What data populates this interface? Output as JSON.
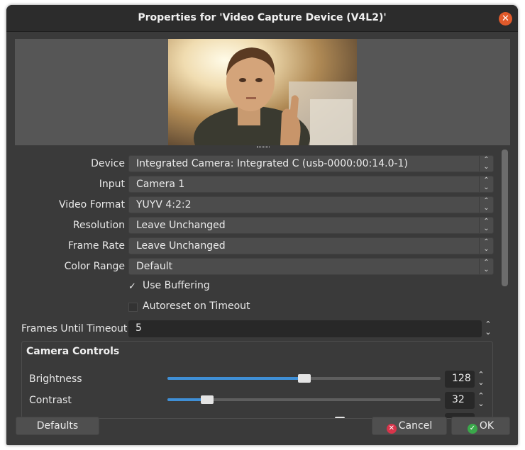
{
  "window": {
    "title": "Properties for 'Video Capture Device (V4L2)'"
  },
  "form": {
    "device": {
      "label": "Device",
      "value": "Integrated Camera: Integrated C (usb-0000:00:14.0-1)"
    },
    "input": {
      "label": "Input",
      "value": "Camera 1"
    },
    "video_format": {
      "label": "Video Format",
      "value": "YUYV 4:2:2"
    },
    "resolution": {
      "label": "Resolution",
      "value": "Leave Unchanged"
    },
    "frame_rate": {
      "label": "Frame Rate",
      "value": "Leave Unchanged"
    },
    "color_range": {
      "label": "Color Range",
      "value": "Default"
    },
    "use_buffering": {
      "label": "Use Buffering",
      "checked": true,
      "mark": "✓"
    },
    "autoreset": {
      "label": "Autoreset on Timeout",
      "checked": false
    },
    "frames_until_timeout": {
      "label": "Frames Until Timeout",
      "value": "5"
    }
  },
  "camera_controls": {
    "title": "Camera Controls",
    "brightness": {
      "label": "Brightness",
      "value": "128",
      "fraction": 0.5
    },
    "contrast": {
      "label": "Contrast",
      "value": "32",
      "fraction": 0.145
    }
  },
  "buttons": {
    "defaults": "Defaults",
    "cancel": "Cancel",
    "ok": "OK"
  },
  "colors": {
    "accent": "#3f8fd6",
    "close": "#e05a2b",
    "cancel_icon": "#d8344a",
    "ok_icon": "#3aa84a"
  },
  "icons": {
    "close": "close-icon",
    "cancel": "cancel-icon",
    "ok": "check-icon",
    "spinner": "up-down-chevron-icon"
  }
}
